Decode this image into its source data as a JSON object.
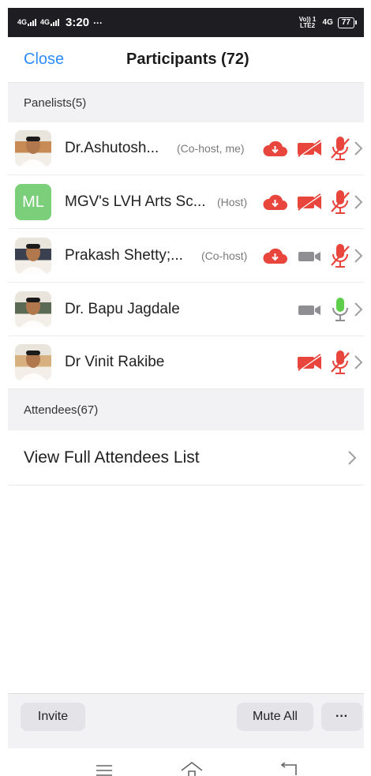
{
  "status_bar": {
    "network_1": "4G",
    "network_2": "4G",
    "time": "3:20",
    "more": "···",
    "volte": "Vo)) 1 LTE2",
    "network_right": "4G",
    "battery": "77"
  },
  "header": {
    "close_label": "Close",
    "title": "Participants (72)"
  },
  "panelists_header": "Panelists(5)",
  "panelists": [
    {
      "name": "Dr.Ashutosh...",
      "tag": "(Co-host, me)",
      "avatar": "photo",
      "avatar_color": "#c98b56",
      "cloud": true,
      "video_muted": true,
      "mic_muted": true
    },
    {
      "name": "MGV's LVH Arts Sc...",
      "tag": "(Host)",
      "avatar": "initials",
      "initials": "ML",
      "avatar_color": "#7ccf7a",
      "cloud": true,
      "video_muted": true,
      "mic_muted": true
    },
    {
      "name": "Prakash Shetty;...",
      "tag": "(Co-host)",
      "avatar": "photo",
      "avatar_color": "#3a4050",
      "cloud": true,
      "video_muted": false,
      "mic_muted": true
    },
    {
      "name": "Dr. Bapu Jagdale",
      "tag": "",
      "avatar": "photo",
      "avatar_color": "#5a6a55",
      "cloud": false,
      "video_muted": false,
      "mic_muted": false
    },
    {
      "name": "Dr Vinit Rakibe",
      "tag": "",
      "avatar": "photo",
      "avatar_color": "#d8b080",
      "cloud": false,
      "video_muted": true,
      "mic_muted": true
    }
  ],
  "attendees_header": "Attendees(67)",
  "view_attendees_label": "View Full Attendees List",
  "bottom_bar": {
    "invite_label": "Invite",
    "mute_all_label": "Mute All",
    "more_label": "···"
  },
  "colors": {
    "accent_blue": "#2d8cff",
    "muted_red": "#e8453c",
    "unmuted_green": "#5fcf4b",
    "inactive_gray": "#8e8e93"
  }
}
